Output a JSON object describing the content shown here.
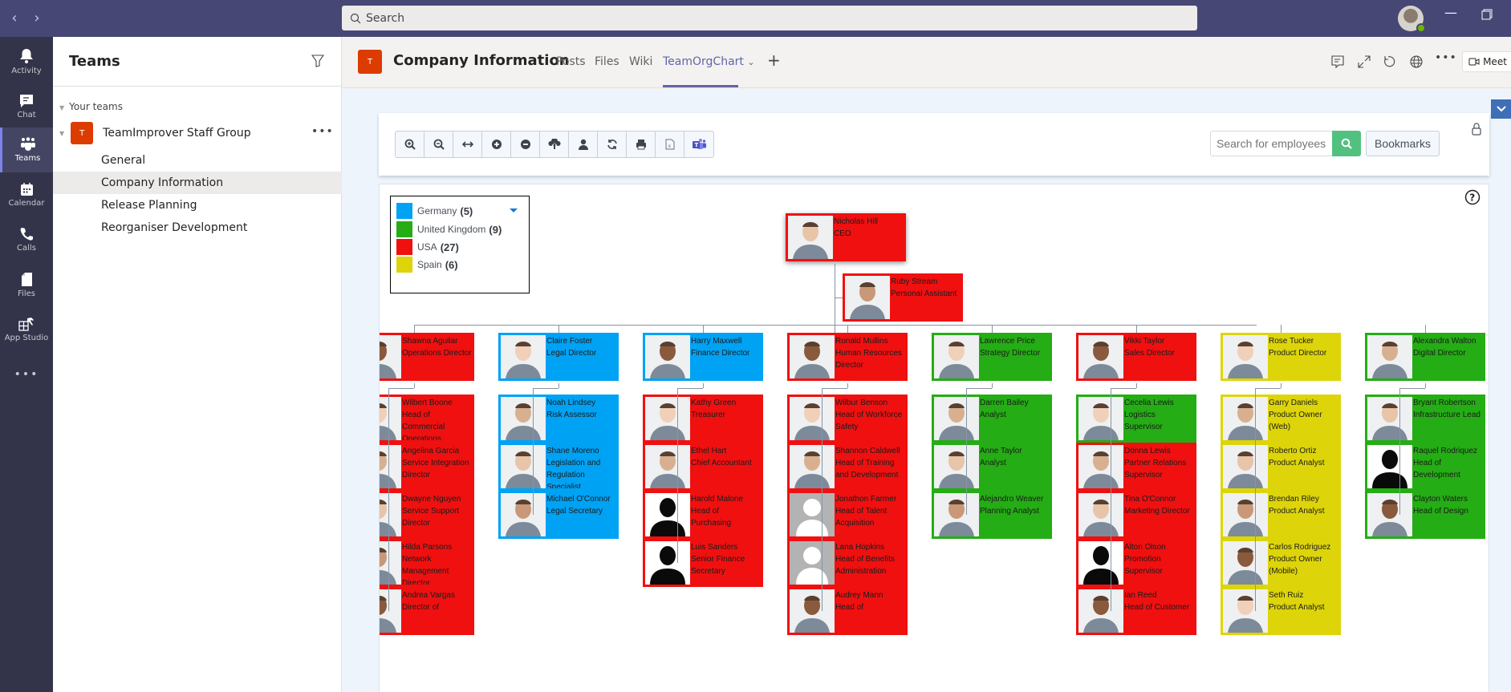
{
  "topbar": {
    "back_icon": "chevron-left-icon",
    "forward_icon": "chevron-right-icon",
    "search_placeholder": "Search",
    "minimize_icon": "minimize-icon",
    "restore_icon": "restore-icon"
  },
  "rail": {
    "items": [
      {
        "label": "Activity",
        "icon": "bell-icon"
      },
      {
        "label": "Chat",
        "icon": "chat-icon"
      },
      {
        "label": "Teams",
        "icon": "teams-icon",
        "active": true
      },
      {
        "label": "Calendar",
        "icon": "calendar-icon"
      },
      {
        "label": "Calls",
        "icon": "phone-icon"
      },
      {
        "label": "Files",
        "icon": "file-icon"
      },
      {
        "label": "App Studio",
        "icon": "app-studio-icon"
      }
    ],
    "more_label": "•••"
  },
  "left_panel": {
    "title": "Teams",
    "section_label": "Your teams",
    "team": {
      "initial": "T",
      "name": "TeamImprover Staff Group",
      "more": "•••"
    },
    "channels": [
      "General",
      "Company Information",
      "Release Planning",
      "Reorganiser Development"
    ],
    "active_channel": "Company Information"
  },
  "header": {
    "initial": "T",
    "title": "Company Information",
    "tabs": [
      {
        "label": "Posts"
      },
      {
        "label": "Files"
      },
      {
        "label": "Wiki"
      },
      {
        "label": "TeamOrgChart",
        "active": true
      }
    ],
    "tab_dropdown": "⌄",
    "add_tab": "+",
    "meet_label": "Meet"
  },
  "orgchart": {
    "toolbar_buttons": [
      "zoom-in",
      "zoom-out",
      "fit-width",
      "expand-all",
      "collapse-all",
      "go-up",
      "my-position",
      "refresh",
      "print",
      "export-excel",
      "teams"
    ],
    "search_placeholder": "Search for employees",
    "bookmarks_label": "Bookmarks",
    "legend": [
      {
        "label": "Germany",
        "count": "(5)",
        "color": "#00a2f4"
      },
      {
        "label": "United Kingdom",
        "count": "(9)",
        "color": "#24ad14"
      },
      {
        "label": "USA",
        "count": "(27)",
        "color": "#f01010"
      },
      {
        "label": "Spain",
        "count": "(6)",
        "color": "#ddd50a"
      }
    ],
    "colors": {
      "germany": "#00a2f4",
      "uk": "#24ad14",
      "usa": "#f01010",
      "spain": "#ddd50a",
      "connector": "#8795a4"
    },
    "ceo": {
      "name": "Nicholas Hill",
      "title": "CEO",
      "country": "usa"
    },
    "assistant": {
      "name": "Ruby Stream",
      "title": "Personal Assistant",
      "country": "usa"
    },
    "departments": [
      {
        "head": {
          "name": "Shawna Aguilar",
          "title": "Operations Director",
          "country": "usa"
        },
        "reports": [
          {
            "name": "Wilbert Boone",
            "title": "Head of Commercial Operations",
            "country": "usa"
          },
          {
            "name": "Angelina Garcia",
            "title": "Service Integration Director",
            "country": "usa"
          },
          {
            "name": "Dwayne Nguyen",
            "title": "Service Support Director",
            "country": "usa"
          },
          {
            "name": "Hilda Parsons",
            "title": "Network Management Director",
            "country": "usa"
          },
          {
            "name": "Andrea Vargas",
            "title": "Director of",
            "country": "usa"
          }
        ]
      },
      {
        "head": {
          "name": "Claire Foster",
          "title": "Legal Director",
          "country": "germany"
        },
        "reports": [
          {
            "name": "Noah Lindsey",
            "title": "Risk Assessor",
            "country": "germany"
          },
          {
            "name": "Shane Moreno",
            "title": "Legislation and Regulation Specialist",
            "country": "germany"
          },
          {
            "name": "Michael O'Connor",
            "title": "Legal Secretary",
            "country": "germany"
          }
        ]
      },
      {
        "head": {
          "name": "Harry Maxwell",
          "title": "Finance Director",
          "country": "germany"
        },
        "reports": [
          {
            "name": "Kathy Green",
            "title": "Treasurer",
            "country": "usa"
          },
          {
            "name": "Ethel Hart",
            "title": "Chief Accountant",
            "country": "usa"
          },
          {
            "name": "Harold Malone",
            "title": "Head of Purchasing",
            "country": "usa",
            "photo": "silhouette"
          },
          {
            "name": "Luis Sanders",
            "title": "Senior Finance Secretary",
            "country": "usa",
            "photo": "silhouette"
          }
        ]
      },
      {
        "head": {
          "name": "Ronald Mullins",
          "title": "Human Resources Director",
          "country": "usa"
        },
        "reports": [
          {
            "name": "Wilbur Benson",
            "title": "Head of Workforce Safety",
            "country": "usa"
          },
          {
            "name": "Shannon Caldwell",
            "title": "Head of Training and Development",
            "country": "usa"
          },
          {
            "name": "Jonathon Farmer",
            "title": "Head of Talent Acquisition",
            "country": "usa",
            "photo": "placeholder"
          },
          {
            "name": "Lana Hopkins",
            "title": "Head of Benefits Administration",
            "country": "usa",
            "photo": "placeholder"
          },
          {
            "name": "Audrey Mann",
            "title": "Head of",
            "country": "usa"
          }
        ]
      },
      {
        "head": {
          "name": "Lawrence Price",
          "title": "Strategy Director",
          "country": "uk"
        },
        "reports": [
          {
            "name": "Darren Bailey",
            "title": "Analyst",
            "country": "uk"
          },
          {
            "name": "Anne Taylor",
            "title": "Analyst",
            "country": "uk"
          },
          {
            "name": "Alejandro Weaver",
            "title": "Planning Analyst",
            "country": "uk"
          }
        ]
      },
      {
        "head": {
          "name": "Vikki Taylor",
          "title": "Sales Director",
          "country": "usa"
        },
        "reports": [
          {
            "name": "Cecelia Lewis",
            "title": "Logistics Supervisor",
            "country": "uk"
          },
          {
            "name": "Donna Lewis",
            "title": "Partner Relations Supervisor",
            "country": "usa"
          },
          {
            "name": "Tina O'Connor",
            "title": "Marketing Director",
            "country": "usa"
          },
          {
            "name": "Alton Olson",
            "title": "Promotion Supervisor",
            "country": "usa",
            "photo": "silhouette"
          },
          {
            "name": "Ian Reed",
            "title": "Head of Customer",
            "country": "usa"
          }
        ]
      },
      {
        "head": {
          "name": "Rose Tucker",
          "title": "Product Director",
          "country": "spain"
        },
        "reports": [
          {
            "name": "Garry Daniels",
            "title": "Product Owner (Web)",
            "country": "spain"
          },
          {
            "name": "Roberto Ortiz",
            "title": "Product Analyst",
            "country": "spain"
          },
          {
            "name": "Brendan Riley",
            "title": "Product Analyst",
            "country": "spain"
          },
          {
            "name": "Carlos Rodriguez",
            "title": "Product Owner (Mobile)",
            "country": "spain"
          },
          {
            "name": "Seth Ruiz",
            "title": "Product Analyst",
            "country": "spain"
          }
        ]
      },
      {
        "head": {
          "name": "Alexandra Walton",
          "title": "Digital Director",
          "country": "uk"
        },
        "reports": [
          {
            "name": "Bryant Robertson",
            "title": "Infrastructure Lead",
            "country": "uk"
          },
          {
            "name": "Raquel Rodriquez",
            "title": "Head of Development",
            "country": "uk",
            "photo": "silhouette"
          },
          {
            "name": "Clayton Waters",
            "title": "Head of Design",
            "country": "uk"
          }
        ]
      }
    ]
  }
}
